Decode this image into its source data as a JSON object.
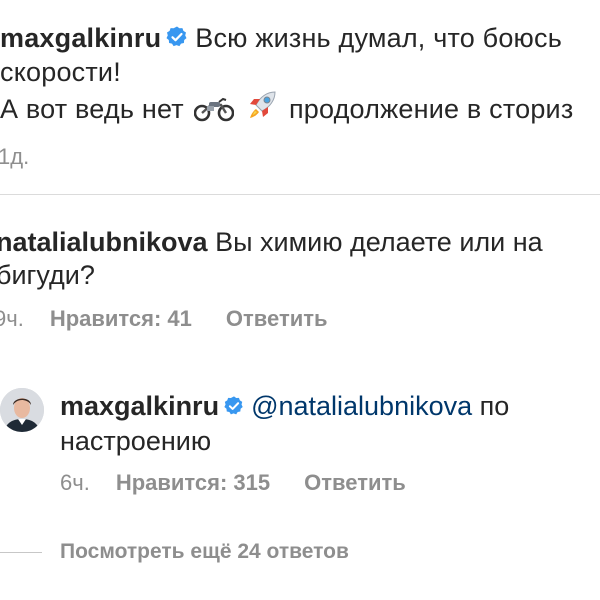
{
  "post": {
    "username": "maxgalkinru",
    "caption_line1": "Всю жизнь думал, что боюсь",
    "caption_line2": "скорости!",
    "caption_line3_a": "А вот ведь нет",
    "caption_line3_b": "продолжение в сториз",
    "emojis": [
      "motorcycle-emoji",
      "rocket-emoji"
    ],
    "time": "1д."
  },
  "comment": {
    "username": "natalialubnikova",
    "text_line1": "Вы химию делаете или на",
    "text_line2": "бигуди?",
    "time": "9ч.",
    "likes": "Нравится: 41",
    "reply_label": "Ответить"
  },
  "reply": {
    "username": "maxgalkinru",
    "mention": "@natalialubnikova",
    "text_tail": "по",
    "text_line2": "настроению",
    "time": "6ч.",
    "likes": "Нравится: 315",
    "reply_label": "Ответить",
    "avatar": "user-avatar"
  },
  "view_more": {
    "label": "Посмотреть ещё 24 ответов"
  },
  "colors": {
    "text": "#262626",
    "secondary": "#8e8e8e",
    "verified": "#3897f0",
    "mention": "#00376b",
    "divider": "#dbdbdb"
  }
}
